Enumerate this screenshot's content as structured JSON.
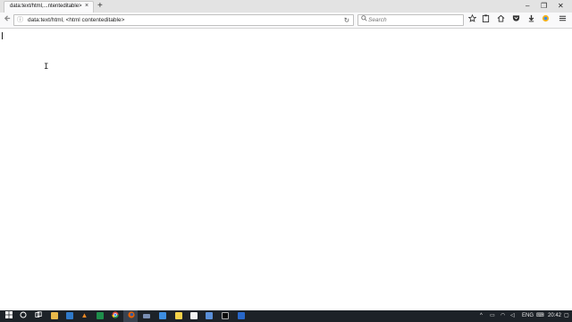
{
  "browser": {
    "tab_title": "data:text/html,...ntenteditable>",
    "tab_close_glyph": "×",
    "new_tab_glyph": "+",
    "url": "data:text/html, <html contenteditable>",
    "search_placeholder": "Search",
    "window_controls": {
      "minimize": "–",
      "restore": "❐",
      "close": "✕"
    },
    "toolbar_icons": [
      "star-icon",
      "clipboard-icon",
      "home-icon",
      "pocket-icon",
      "download-icon",
      "addon-icon",
      "menu-icon"
    ]
  },
  "taskbar": {
    "language": "ENG",
    "time": "20:42",
    "icons": [
      "windows-start-icon",
      "cortana-icon",
      "task-view-icon",
      "file-explorer-icon",
      "store-icon",
      "vlc-icon",
      "excel-icon",
      "chrome-icon",
      "firefox-icon",
      "keyboard-icon",
      "mail-icon",
      "notes-icon",
      "photos-icon",
      "tasks-icon",
      "terminal-icon",
      "news-icon"
    ]
  }
}
